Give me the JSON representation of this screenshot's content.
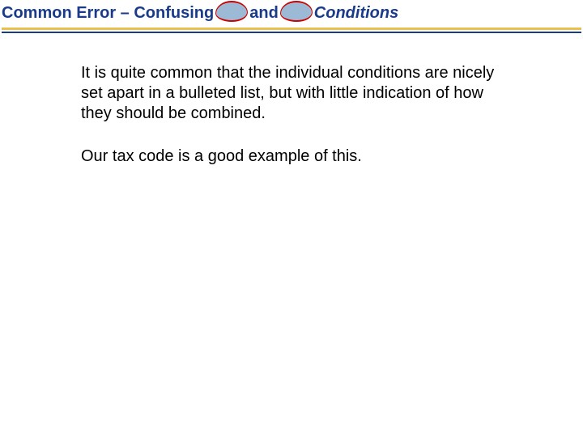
{
  "title": {
    "part1": "Common Error – Confusing",
    "connector": "and",
    "part2": "Conditions"
  },
  "body": {
    "p1": "It is quite common that the individual conditions are nicely set apart in a bulleted list, but with little indication of how they should be combined.",
    "p2": "Our tax code is a good example of this."
  },
  "colors": {
    "titleColor": "#1a3a8a",
    "underlineYellow": "#e9c14a",
    "underlineBlue": "#1a3a8a",
    "blobFill": "#9cb9d6",
    "blobBorder": "#cc0000"
  }
}
